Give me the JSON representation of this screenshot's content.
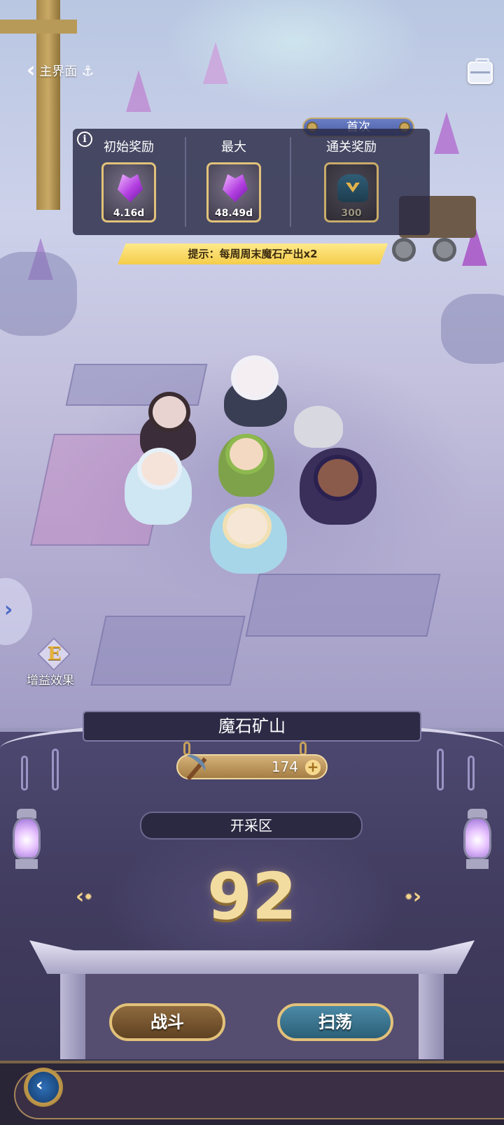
{
  "nav": {
    "back_label": "主界面",
    "anchor_icon": "anchor-icon",
    "toolbox_icon": "toolbox-icon"
  },
  "rewards": {
    "initial": {
      "label": "初始奖励",
      "count": "4.16d",
      "icon": "purple-crystal-icon"
    },
    "max": {
      "label": "最大",
      "count": "48.49d",
      "icon": "purple-crystal-icon"
    },
    "clear": {
      "label": "通关奖励",
      "count": "300",
      "icon": "gem-pouch-icon",
      "tag": "首次"
    }
  },
  "tip": "提示：每周周末魔石产出x2",
  "buff": {
    "label": "增益效果",
    "icon": "buff-e-icon"
  },
  "stage": {
    "title": "魔石矿山",
    "stamina": "174",
    "zone": "开采区",
    "level": "92"
  },
  "actions": {
    "fight": "战斗",
    "sweep": "扫荡"
  },
  "colors": {
    "accent_gold": "#e2c17a",
    "panel": "#3f3b5c",
    "tip_yellow": "#f4cd4a"
  }
}
